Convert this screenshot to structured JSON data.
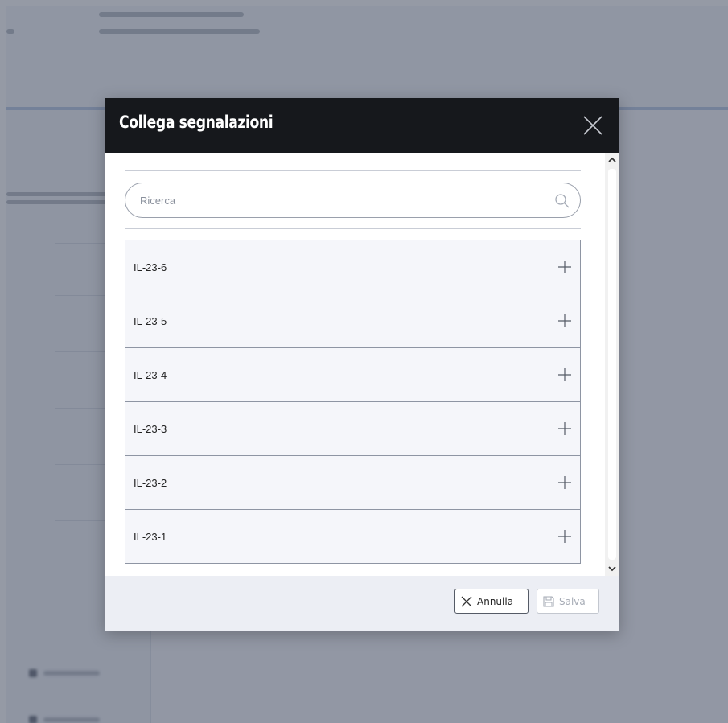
{
  "modal": {
    "title": "Collega segnalazioni",
    "search": {
      "placeholder": "Ricerca",
      "value": ""
    },
    "items": [
      {
        "label": "IL-23-6"
      },
      {
        "label": "IL-23-5"
      },
      {
        "label": "IL-23-4"
      },
      {
        "label": "IL-23-3"
      },
      {
        "label": "IL-23-2"
      },
      {
        "label": "IL-23-1"
      }
    ],
    "footer": {
      "cancel_label": "Annulla",
      "save_label": "Salva"
    }
  },
  "icons": {
    "close": "close-icon",
    "search": "search-icon",
    "add": "plus-icon",
    "cancel": "x-icon",
    "save": "floppy-disk-icon",
    "scroll_up": "chevron-up-icon",
    "scroll_down": "chevron-down-icon"
  },
  "colors": {
    "modal_header": "#16181c",
    "overlay": "#545c6e",
    "list_item_bg": "#f5f6fa",
    "list_item_border": "#8e95a3",
    "footer_bg": "#eceef4",
    "disabled_text": "#a6abb5"
  }
}
